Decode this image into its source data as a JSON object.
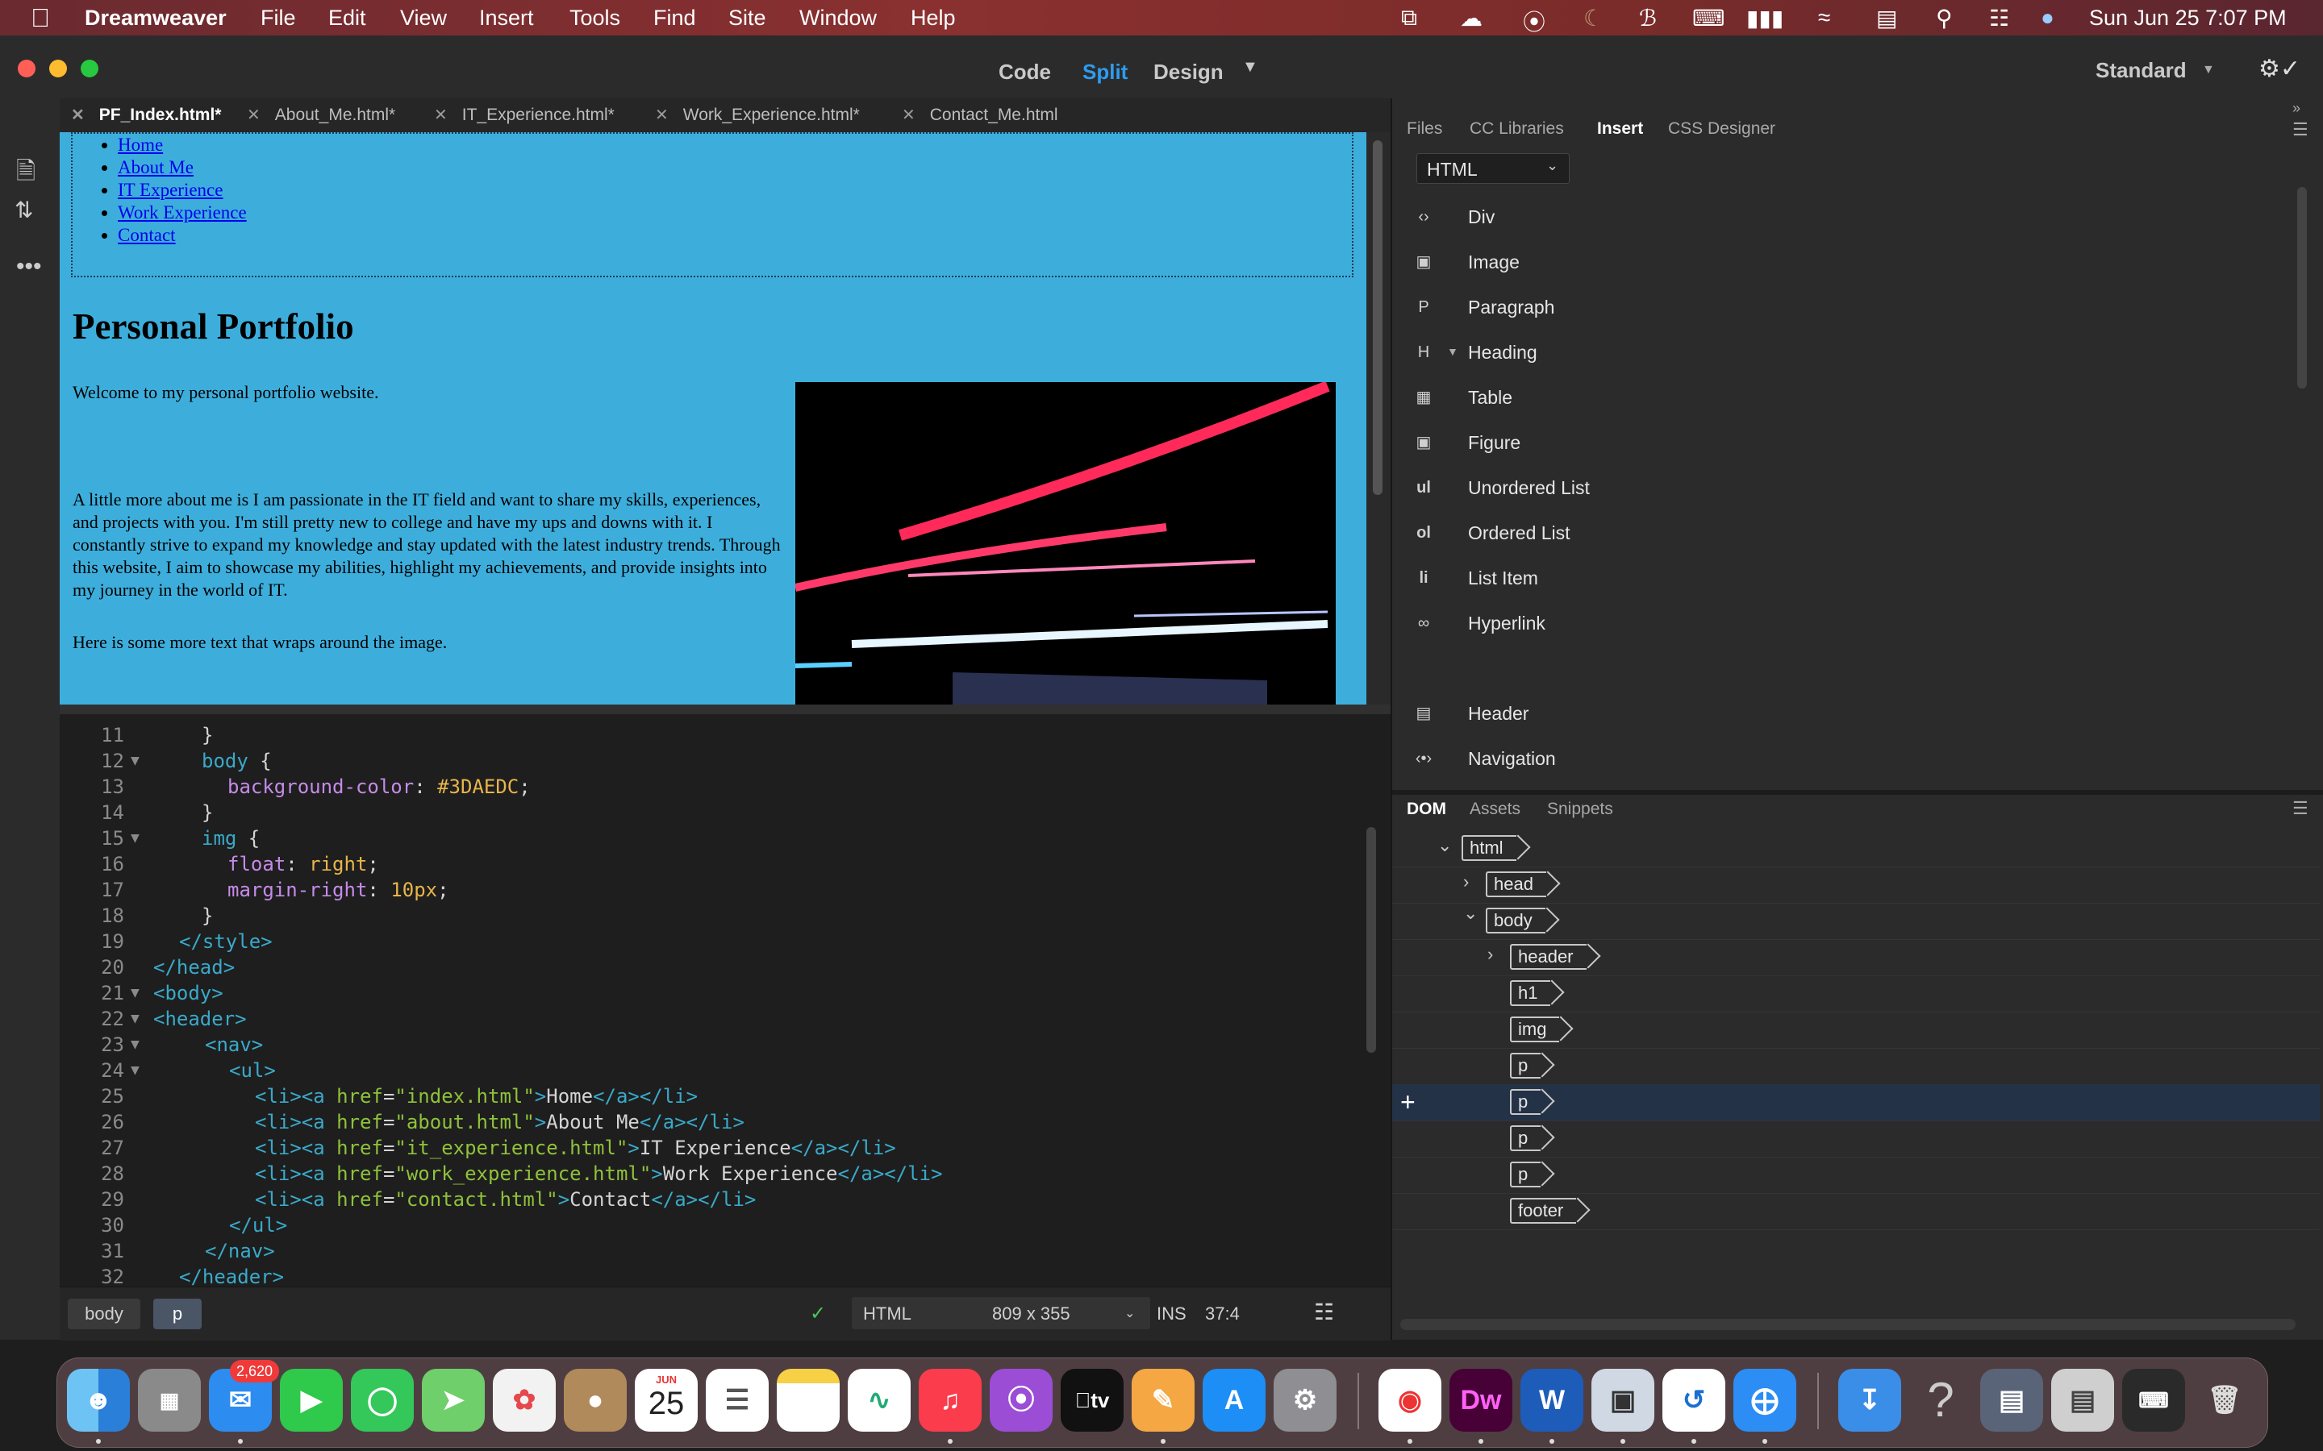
{
  "menubar": {
    "app_name": "Dreamweaver",
    "items": [
      "File",
      "Edit",
      "View",
      "Insert",
      "Tools",
      "Find",
      "Site",
      "Window",
      "Help"
    ],
    "datetime": "Sun Jun 25  7:07 PM"
  },
  "toolbar": {
    "views": [
      "Code",
      "Split",
      "Design"
    ],
    "active_view": "Split",
    "workspace": "Standard"
  },
  "doc_tabs": [
    {
      "label": "PF_Index.html*",
      "active": true
    },
    {
      "label": "About_Me.html*",
      "active": false
    },
    {
      "label": "IT_Experience.html*",
      "active": false
    },
    {
      "label": "Work_Experience.html*",
      "active": false
    },
    {
      "label": "Contact_Me.html",
      "active": false
    }
  ],
  "live": {
    "nav": [
      "Home",
      "About Me",
      "IT Experience",
      "Work Experience",
      "Contact"
    ],
    "heading": "Personal Portfolio",
    "p1": "Welcome to my personal portfolio website.",
    "p2": "A little more about me is I am passionate in the IT field and want to share my skills, experiences, and projects with you. I'm still pretty new to college and have my ups and downs with it. I constantly strive to expand my knowledge and stay updated with the latest industry trends. Through this website, I aim to showcase my abilities, highlight my achievements, and provide insights into my journey in the world of IT.",
    "p3": "Here is some more text that wraps around the image.",
    "bg_color": "#3DAEDC"
  },
  "code": {
    "line_numbers": [
      "11",
      "12",
      "13",
      "14",
      "15",
      "16",
      "17",
      "18",
      "19",
      "20",
      "21",
      "22",
      "23",
      "24",
      "25",
      "26",
      "27",
      "28",
      "29",
      "30",
      "31",
      "32"
    ],
    "text": {
      "l11": "}",
      "l12_sel": "body",
      "l12_rest": " {",
      "l13_prop": "background-color",
      "l13_val": "#3DAEDC",
      "l14": "}",
      "l15_sel": "img",
      "l15_rest": " {",
      "l16_prop": "float",
      "l16_val": "right",
      "l17_prop": "margin-right",
      "l17_val": "10px",
      "l18": "}",
      "l19": "</style>",
      "l20": "</head>",
      "l21": "<body>",
      "l22": "<header>",
      "l23": "<nav>",
      "l24": "<ul>",
      "links": [
        {
          "href": "\"index.html\"",
          "text": "Home"
        },
        {
          "href": "\"about.html\"",
          "text": "About Me"
        },
        {
          "href": "\"it_experience.html\"",
          "text": "IT Experience"
        },
        {
          "href": "\"work_experience.html\"",
          "text": "Work Experience"
        },
        {
          "href": "\"contact.html\"",
          "text": "Contact"
        }
      ],
      "l30": "</ul>",
      "l31": "</nav>",
      "l32": "</header>"
    }
  },
  "statusbar": {
    "crumbs": [
      "body",
      "p"
    ],
    "doc_type": "HTML",
    "size": "809 x 355",
    "mode": "INS",
    "position": "37:4"
  },
  "panel_top": {
    "tabs": [
      "Files",
      "CC Libraries",
      "Insert",
      "CSS Designer"
    ],
    "active_tab": "Insert",
    "category": "HTML",
    "items": [
      "Div",
      "Image",
      "Paragraph",
      "Heading",
      "Table",
      "Figure",
      "Unordered List",
      "Ordered List",
      "List Item",
      "Hyperlink",
      "Header",
      "Navigation"
    ],
    "icons": [
      "div-icon",
      "image-icon",
      "paragraph-icon",
      "heading-icon",
      "table-icon",
      "figure-icon",
      "unordered-list-icon",
      "ordered-list-icon",
      "list-item-icon",
      "hyperlink-icon",
      "header-icon",
      "navigation-icon"
    ]
  },
  "panel_bottom": {
    "tabs": [
      "DOM",
      "Assets",
      "Snippets"
    ],
    "active_tab": "DOM",
    "nodes": [
      "html",
      "head",
      "body",
      "header",
      "h1",
      "img",
      "p",
      "p",
      "p",
      "p",
      "footer"
    ]
  },
  "dock": {
    "mail_badge": "2,620",
    "calendar_month": "JUN",
    "calendar_day": "25",
    "dw_label": "Dw",
    "apps": [
      "Finder",
      "Launchpad",
      "Mail",
      "FaceTime",
      "Messages",
      "Maps",
      "Photos",
      "Contacts",
      "Calendar",
      "Reminders",
      "Notes",
      "Freeform",
      "Music",
      "Podcasts",
      "TV",
      "Pages",
      "App Store",
      "System Settings",
      "Chrome",
      "Dreamweaver",
      "Word",
      "Preview",
      "Remote Desktop",
      "Safari",
      "Downloads",
      "Help",
      "Screenshots",
      "Documents",
      "Keyboard",
      "Trash"
    ]
  },
  "colors": {
    "accent": "#1b8be0",
    "live_bg": "#3DAEDC",
    "tag": "#3aa9c9",
    "string": "#8fc23a"
  }
}
